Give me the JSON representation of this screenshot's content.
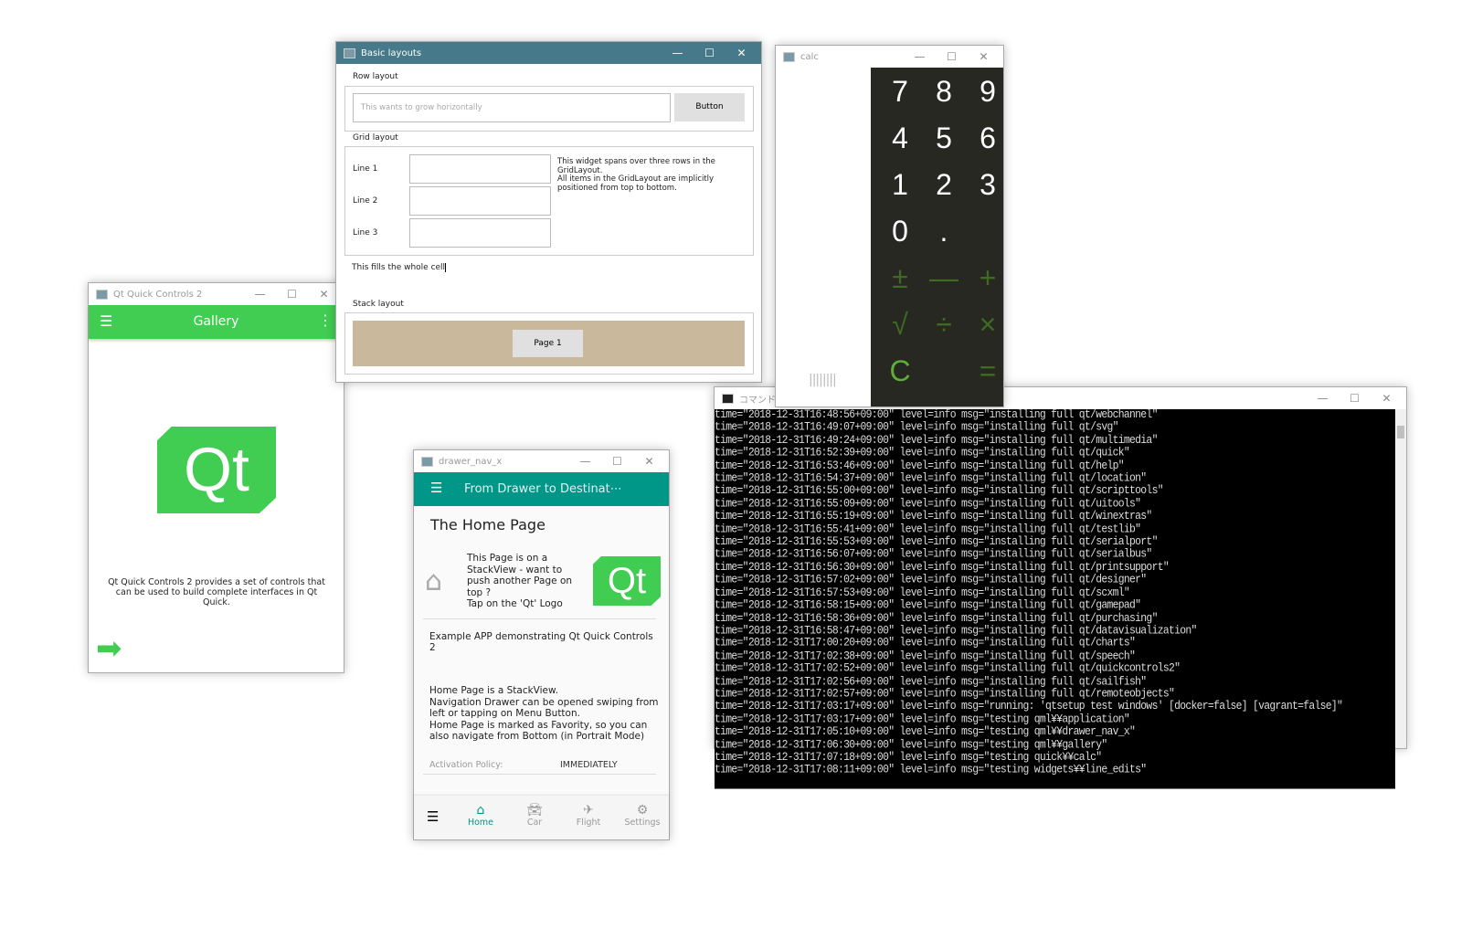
{
  "basic": {
    "title": "Basic layouts",
    "row_label": "Row layout",
    "input_placeholder": "This wants to grow horizontally",
    "button": "Button",
    "grid_label": "Grid layout",
    "line1": "Line 1",
    "line2": "Line 2",
    "line3": "Line 3",
    "span_text": "This widget spans over three rows in the GridLayout.\nAll items in the GridLayout are implicitly positioned from top to bottom.",
    "fill_text": "This fills the whole cell",
    "stack_label": "Stack layout",
    "page_button": "Page 1"
  },
  "calc": {
    "title": "calc",
    "digits": [
      "7",
      "8",
      "9",
      "4",
      "5",
      "6",
      "1",
      "2",
      "3",
      "0",
      "."
    ],
    "ops": [
      "±",
      "—",
      "+",
      "√",
      "÷",
      "×",
      "C",
      "",
      "="
    ],
    "handle": "||||||||"
  },
  "gallery": {
    "title": "Qt Quick Controls 2",
    "header": "Gallery",
    "logo": "Qt",
    "description": "Qt Quick Controls 2 provides a set of controls that can be used to build complete interfaces in Qt Quick."
  },
  "drawer": {
    "title": "drawer_nav_x",
    "header": "From Drawer to Destinat⋯",
    "page_title": "The Home Page",
    "stack_text": "This Page is on a StackView - want to push another Page on top ?\nTap on the 'Qt' Logo",
    "logo": "Qt",
    "example": "Example APP demonstrating Qt Quick Controls 2",
    "info": "Home Page is a StackView.\nNavigation Drawer can be opened swiping from left or tapping on Menu Button.\nHome Page is marked as Favority, so you can also navigate from Bottom (in Portrait Mode)",
    "policy_label": "Activation Policy:",
    "policy_value": "IMMEDIATELY",
    "nav": [
      "Home",
      "Car",
      "Flight",
      "Settings"
    ],
    "accent": "#009688"
  },
  "terminal": {
    "title": "コマンド プロンプト",
    "lines": [
      "time=\"2018-12-31T16:48:56+09:00\" level=info msg=\"installing full qt/webchannel\"",
      "time=\"2018-12-31T16:49:07+09:00\" level=info msg=\"installing full qt/svg\"",
      "time=\"2018-12-31T16:49:24+09:00\" level=info msg=\"installing full qt/multimedia\"",
      "time=\"2018-12-31T16:52:39+09:00\" level=info msg=\"installing full qt/quick\"",
      "time=\"2018-12-31T16:53:46+09:00\" level=info msg=\"installing full qt/help\"",
      "time=\"2018-12-31T16:54:37+09:00\" level=info msg=\"installing full qt/location\"",
      "time=\"2018-12-31T16:55:00+09:00\" level=info msg=\"installing full qt/scripttools\"",
      "time=\"2018-12-31T16:55:09+09:00\" level=info msg=\"installing full qt/uitools\"",
      "time=\"2018-12-31T16:55:19+09:00\" level=info msg=\"installing full qt/winextras\"",
      "time=\"2018-12-31T16:55:41+09:00\" level=info msg=\"installing full qt/testlib\"",
      "time=\"2018-12-31T16:55:53+09:00\" level=info msg=\"installing full qt/serialport\"",
      "time=\"2018-12-31T16:56:07+09:00\" level=info msg=\"installing full qt/serialbus\"",
      "time=\"2018-12-31T16:56:30+09:00\" level=info msg=\"installing full qt/printsupport\"",
      "time=\"2018-12-31T16:57:02+09:00\" level=info msg=\"installing full qt/designer\"",
      "time=\"2018-12-31T16:57:53+09:00\" level=info msg=\"installing full qt/scxml\"",
      "time=\"2018-12-31T16:58:15+09:00\" level=info msg=\"installing full qt/gamepad\"",
      "time=\"2018-12-31T16:58:36+09:00\" level=info msg=\"installing full qt/purchasing\"",
      "time=\"2018-12-31T16:58:47+09:00\" level=info msg=\"installing full qt/datavisualization\"",
      "time=\"2018-12-31T17:00:20+09:00\" level=info msg=\"installing full qt/charts\"",
      "time=\"2018-12-31T17:02:38+09:00\" level=info msg=\"installing full qt/speech\"",
      "time=\"2018-12-31T17:02:52+09:00\" level=info msg=\"installing full qt/quickcontrols2\"",
      "time=\"2018-12-31T17:02:56+09:00\" level=info msg=\"installing full qt/sailfish\"",
      "time=\"2018-12-31T17:02:57+09:00\" level=info msg=\"installing full qt/remoteobjects\"",
      "time=\"2018-12-31T17:03:17+09:00\" level=info msg=\"running: 'qtsetup test windows' [docker=false] [vagrant=false]\"",
      "time=\"2018-12-31T17:03:17+09:00\" level=info msg=\"testing qml¥¥application\"",
      "time=\"2018-12-31T17:05:10+09:00\" level=info msg=\"testing qml¥¥drawer_nav_x\"",
      "time=\"2018-12-31T17:06:30+09:00\" level=info msg=\"testing qml¥¥gallery\"",
      "time=\"2018-12-31T17:07:18+09:00\" level=info msg=\"testing quick¥¥calc\"",
      "time=\"2018-12-31T17:08:11+09:00\" level=info msg=\"testing widgets¥¥line_edits\""
    ]
  },
  "window_controls": {
    "min": "—",
    "max": "☐",
    "close": "✕"
  }
}
